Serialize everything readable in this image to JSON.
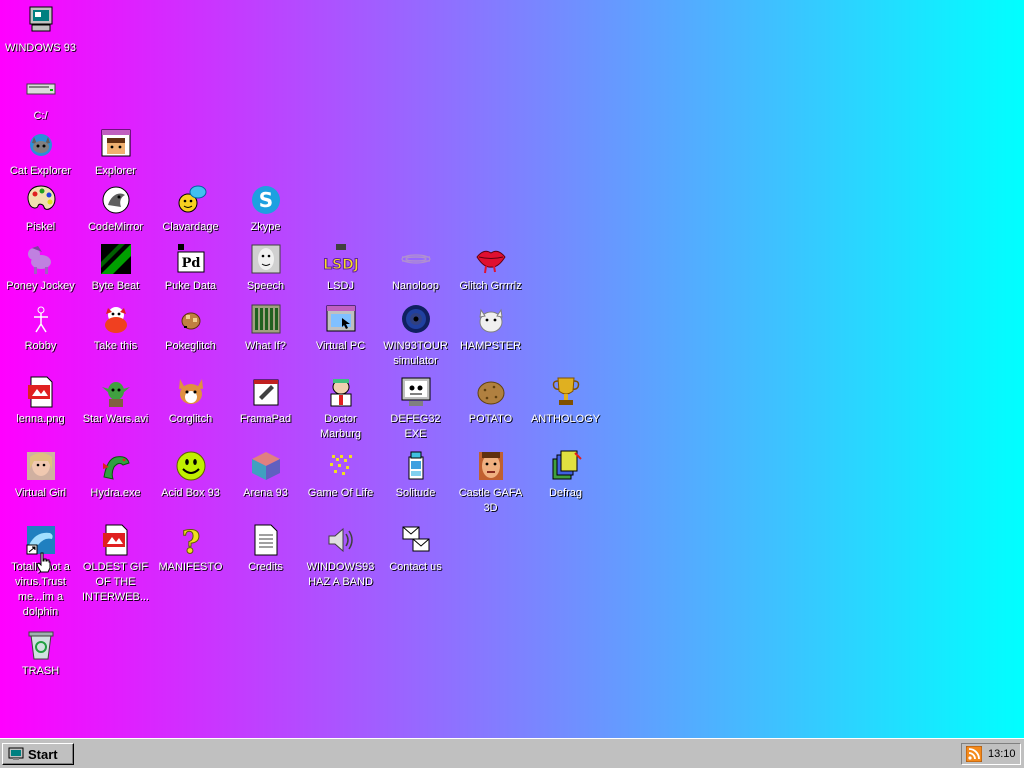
{
  "desktop": {
    "icons": [
      {
        "label": "WINDOWS 93",
        "icon": "computer-icon"
      },
      {
        "label": "C:/",
        "icon": "drive-icon"
      },
      {
        "label": "Cat Explorer",
        "icon": "cat-explorer-icon"
      },
      {
        "label": "Explorer",
        "icon": "explorer-icon"
      },
      {
        "label": "Piskel",
        "icon": "palette-icon"
      },
      {
        "label": "CodeMirror",
        "icon": "codemirror-icon"
      },
      {
        "label": "Clavardage",
        "icon": "chat-icon"
      },
      {
        "label": "Zkype",
        "icon": "zkype-icon"
      },
      {
        "label": "Poney Jockey",
        "icon": "pony-icon"
      },
      {
        "label": "Byte Beat",
        "icon": "bytebeat-icon"
      },
      {
        "label": "Puke Data",
        "icon": "pd-icon"
      },
      {
        "label": "Speech",
        "icon": "speech-icon"
      },
      {
        "label": "LSDJ",
        "icon": "lsdj-icon"
      },
      {
        "label": "Nanoloop",
        "icon": "nanoloop-icon"
      },
      {
        "label": "Glitch Grrrrlz",
        "icon": "lips-icon"
      },
      {
        "label": "Robby",
        "icon": "robby-icon"
      },
      {
        "label": "Take this",
        "icon": "take-this-icon"
      },
      {
        "label": "Pokeglitch",
        "icon": "pokeglitch-icon"
      },
      {
        "label": "What If?",
        "icon": "what-if-icon"
      },
      {
        "label": "Virtual PC",
        "icon": "virtual-pc-icon"
      },
      {
        "label": "WIN93TOUR simulator",
        "icon": "vortex-icon"
      },
      {
        "label": "HAMPSTER",
        "icon": "hampster-icon"
      },
      {
        "label": "lenna.png",
        "icon": "image-file-icon"
      },
      {
        "label": "Star Wars.avi",
        "icon": "yoda-icon"
      },
      {
        "label": "Corglitch",
        "icon": "corgi-icon"
      },
      {
        "label": "FramaPad",
        "icon": "framapad-icon"
      },
      {
        "label": "Doctor Marburg",
        "icon": "doctor-icon"
      },
      {
        "label": "DEFEG32 EXE",
        "icon": "defeg-icon"
      },
      {
        "label": "POTATO",
        "icon": "potato-icon"
      },
      {
        "label": "ANTHOLOGY",
        "icon": "trophy-icon"
      },
      {
        "label": "Virtual Girl",
        "icon": "virtual-girl-icon"
      },
      {
        "label": "Hydra.exe",
        "icon": "hydra-icon"
      },
      {
        "label": "Acid Box 93",
        "icon": "smiley-icon"
      },
      {
        "label": "Arena 93",
        "icon": "cube-icon"
      },
      {
        "label": "Game Of Life",
        "icon": "game-of-life-icon"
      },
      {
        "label": "Solitude",
        "icon": "solitude-icon"
      },
      {
        "label": "Castle GAFA 3D",
        "icon": "castle-face-icon"
      },
      {
        "label": "Defrag",
        "icon": "defrag-icon"
      },
      {
        "label": "Totally not a virus.Trust me...im a dolphin",
        "icon": "dolphin-icon"
      },
      {
        "label": "OLDEST GIF OF THE INTERWEB...",
        "icon": "gif-file-icon"
      },
      {
        "label": "MANIFESTO",
        "icon": "question-icon"
      },
      {
        "label": "Credits",
        "icon": "document-icon"
      },
      {
        "label": "WINDOWS93 HAZ A BAND",
        "icon": "speaker-icon"
      },
      {
        "label": "Contact us",
        "icon": "contact-icon"
      },
      {
        "label": "TRASH",
        "icon": "trash-icon"
      }
    ]
  },
  "taskbar": {
    "start_label": "Start",
    "clock": "13:10",
    "tray_icon": "rss-icon"
  }
}
